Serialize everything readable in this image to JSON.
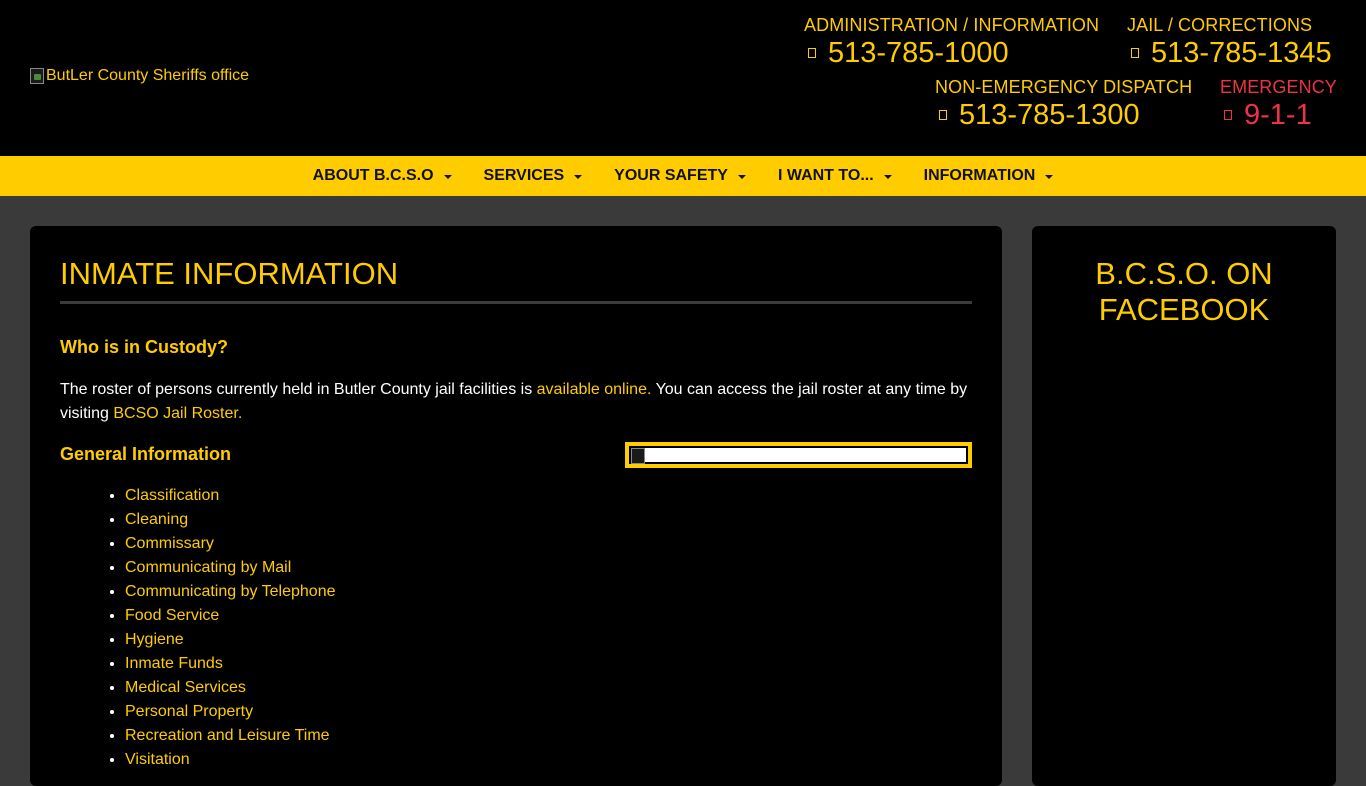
{
  "header": {
    "logo_alt": "ButLer County Sheriffs office",
    "contacts": {
      "admin": {
        "label": "ADMINISTRATION / INFORMATION",
        "phone": "513-785-1000"
      },
      "jail": {
        "label": "JAIL / CORRECTIONS",
        "phone": "513-785-1345"
      },
      "dispatch": {
        "label": "NON-EMERGENCY DISPATCH",
        "phone": "513-785-1300"
      },
      "emergency": {
        "label": "EMERGENCY",
        "phone": "9-1-1"
      }
    }
  },
  "nav": {
    "items": [
      {
        "label": "ABOUT B.C.S.O"
      },
      {
        "label": "SERVICES"
      },
      {
        "label": "YOUR SAFETY"
      },
      {
        "label": "I WANT TO..."
      },
      {
        "label": "INFORMATION"
      }
    ]
  },
  "main": {
    "title": "INMATE INFORMATION",
    "custody_heading": "Who is in Custody?",
    "paragraph": {
      "text_1": "The roster of persons currently held in Butler County jail facilities is ",
      "link_1": "available online.",
      "text_2": " You can access the jail roster at any time by visiting ",
      "link_2": "BCSO Jail Roster."
    },
    "general_heading": "General Information",
    "info_links": [
      "Classification",
      "Cleaning",
      "Commissary",
      "Communicating by Mail",
      "Communicating by Telephone",
      "Food Service",
      "Hygiene",
      "Inmate Funds",
      "Medical Services",
      "Personal Property",
      "Recreation and Leisure Time",
      "Visitation"
    ]
  },
  "sidebar": {
    "title_line1": "B.C.S.O. ON",
    "title_line2": "FACEBOOK"
  },
  "colors": {
    "accent": "#ffcc00",
    "emergency": "#ee3344",
    "background": "#3a3a3a",
    "panel": "#000000"
  },
  "icons": [
    "phone-icon",
    "caret-down-icon",
    "broken-image-icon"
  ]
}
